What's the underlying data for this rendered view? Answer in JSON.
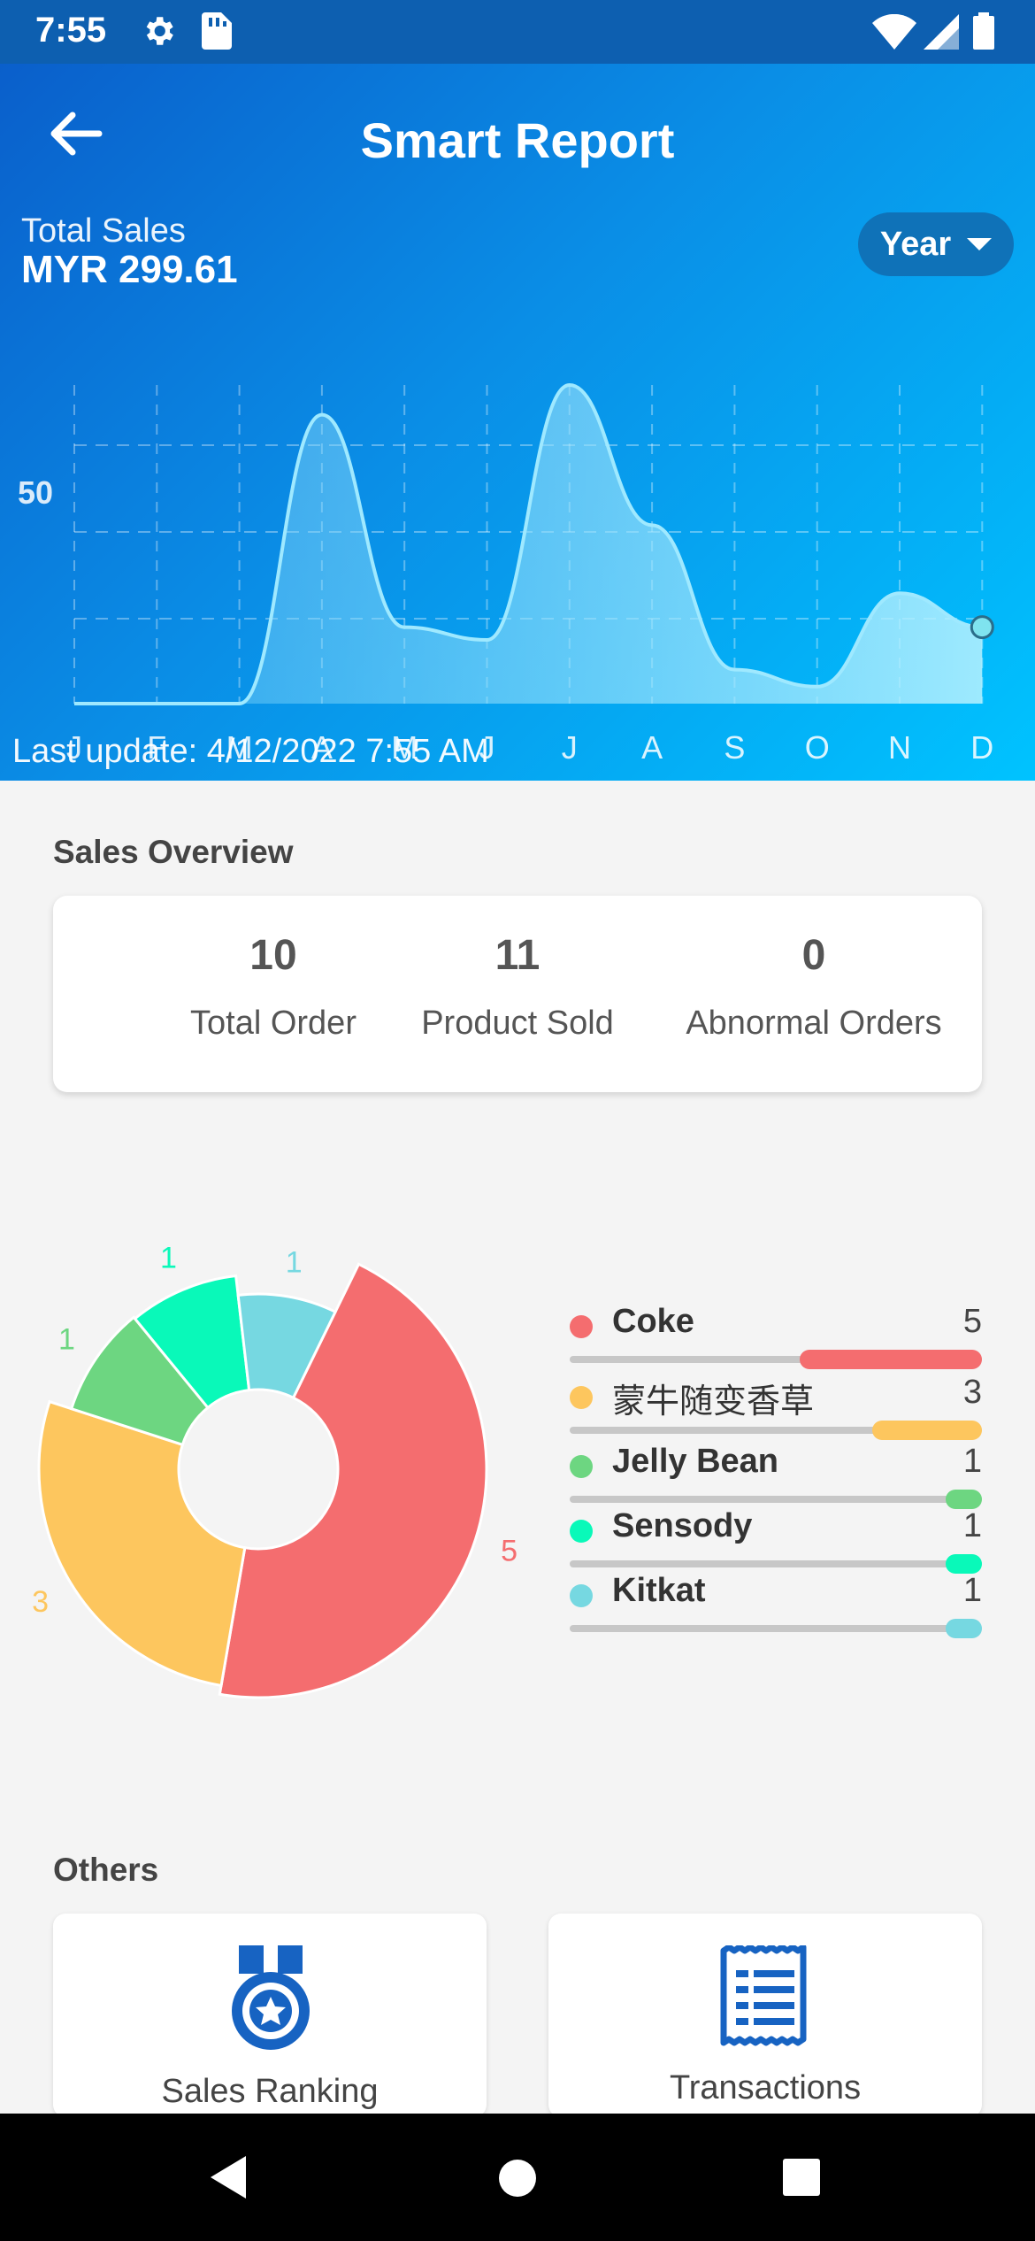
{
  "status_bar": {
    "time": "7:55",
    "icons": [
      "gear-icon",
      "sim-card-icon",
      "wifi-icon",
      "signal-icon",
      "battery-icon"
    ]
  },
  "header": {
    "title": "Smart Report",
    "total_sales_label": "Total Sales",
    "total_sales_value": "MYR 299.61",
    "period_select": "Year",
    "last_update": "Last update: 4/12/2022 7:55 AM"
  },
  "chart_data": {
    "type": "area",
    "categories": [
      "J",
      "F",
      "M",
      "A",
      "M",
      "J",
      "J",
      "A",
      "S",
      "O",
      "N",
      "D"
    ],
    "y_tick_labels": [
      "50"
    ],
    "ylim": [
      0,
      75
    ],
    "values": [
      0,
      0,
      0,
      68,
      18,
      15,
      75,
      42,
      8,
      4,
      26,
      18
    ],
    "grid": true,
    "color": "#9fe9ff"
  },
  "sales_overview": {
    "title": "Sales Overview",
    "stats": [
      {
        "value": "10",
        "label": "Total Order"
      },
      {
        "value": "11",
        "label": "Product Sold"
      },
      {
        "value": "0",
        "label": "Abnormal Orders"
      }
    ]
  },
  "product_chart": {
    "type": "pie",
    "items": [
      {
        "name": "Coke",
        "value": 5,
        "color": "#f46d6f"
      },
      {
        "name": "蒙牛随变香草",
        "value": 3,
        "color": "#fdc65e"
      },
      {
        "name": "Jelly Bean",
        "value": 1,
        "color": "#6dd681"
      },
      {
        "name": "Sensody",
        "value": 1,
        "color": "#09f9b9"
      },
      {
        "name": "Kitkat",
        "value": 1,
        "color": "#76d8e1"
      }
    ]
  },
  "others": {
    "title": "Others",
    "cards": [
      {
        "label": "Sales Ranking",
        "icon": "medal-icon"
      },
      {
        "label": "Transactions",
        "icon": "receipt-icon"
      }
    ]
  },
  "nav_bar": {
    "icons": [
      "back-triangle-icon",
      "home-circle-icon",
      "recents-square-icon"
    ]
  }
}
